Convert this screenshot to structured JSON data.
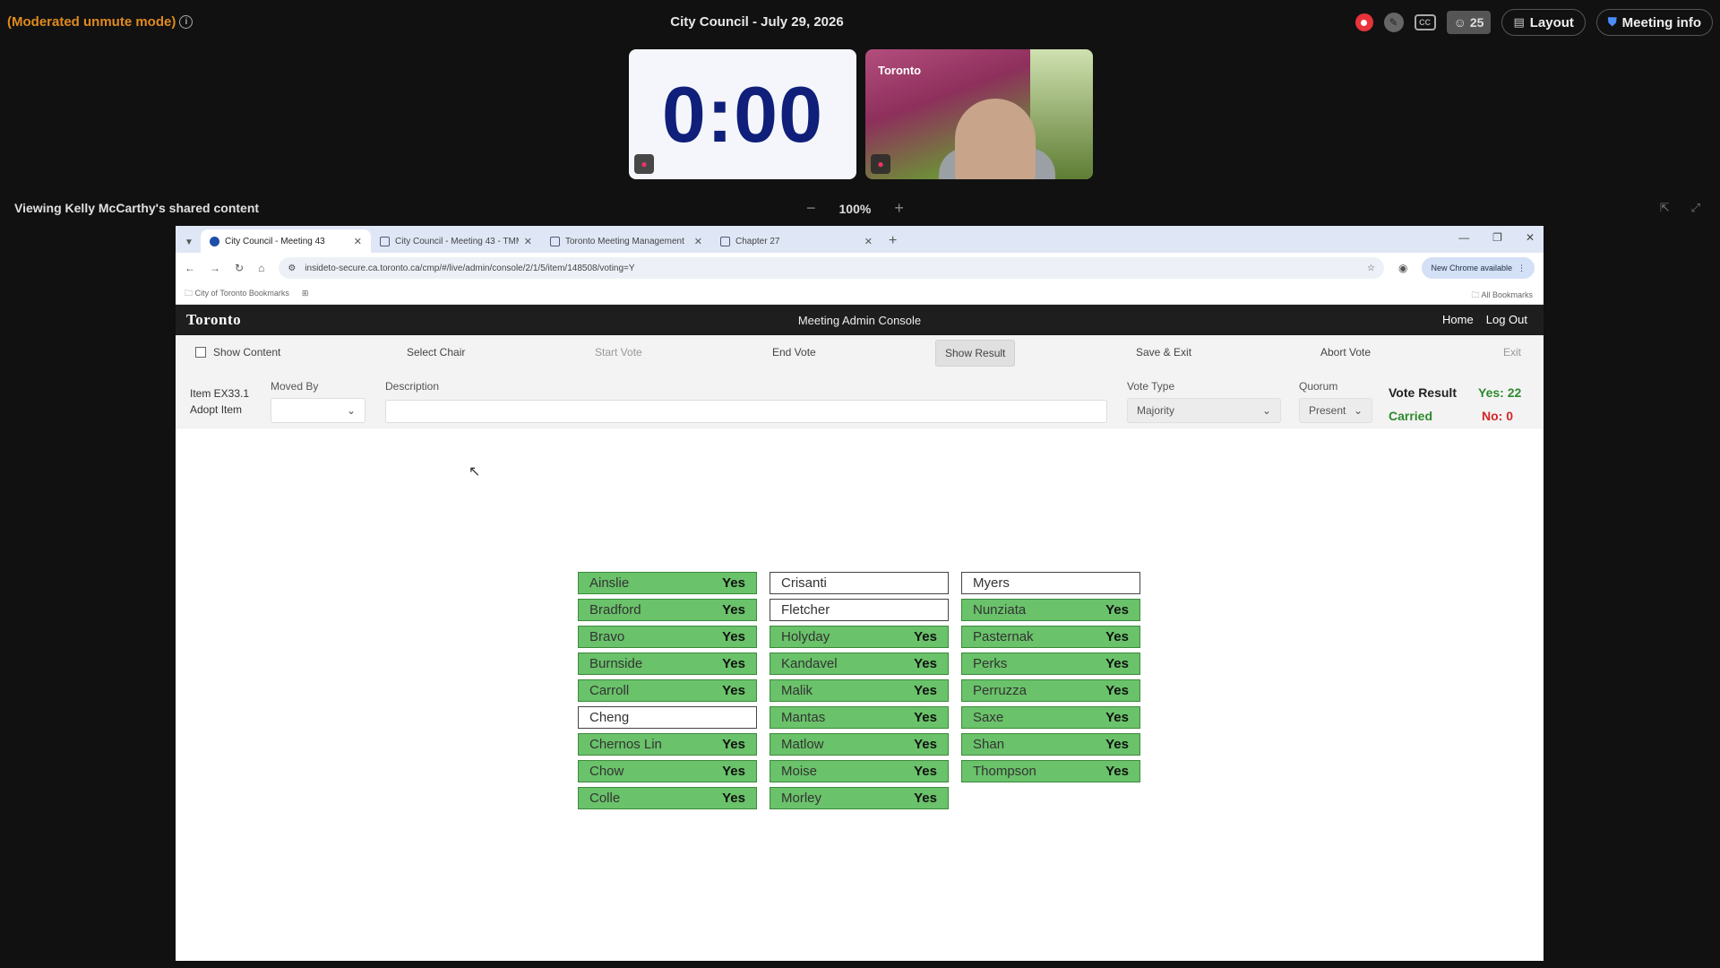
{
  "meeting": {
    "mode": "(Moderated unmute mode)",
    "title": "City Council - July 29, 2026",
    "participants": "25",
    "layout_label": "Layout",
    "info_label": "Meeting info",
    "timer": "0:00",
    "video_logo": "Toronto"
  },
  "share": {
    "label": "Viewing Kelly McCarthy's shared content",
    "zoom": "100%",
    "zoom_out": "−",
    "zoom_in": "+"
  },
  "browser": {
    "tabs": [
      {
        "label": "City Council - Meeting 43",
        "active": true
      },
      {
        "label": "City Council - Meeting 43 - TMMIS",
        "active": false
      },
      {
        "label": "Toronto Meeting Management",
        "active": false
      },
      {
        "label": "Chapter 27",
        "active": false
      }
    ],
    "url": "insideto-secure.ca.toronto.ca/cmp/#/live/admin/console/2/1/5/item/148508/voting=Y",
    "update_label": "New Chrome available",
    "bookmark_folder": "City of Toronto Bookmarks",
    "all_bookmarks": "All Bookmarks"
  },
  "app": {
    "logo": "Toronto",
    "title": "Meeting Admin Console",
    "nav_home": "Home",
    "nav_logout": "Log Out",
    "toolbar": {
      "show_content": "Show Content",
      "select_chair": "Select Chair",
      "start_vote": "Start Vote",
      "end_vote": "End Vote",
      "show_result": "Show Result",
      "save_exit": "Save & Exit",
      "abort_vote": "Abort Vote",
      "exit": "Exit"
    },
    "form": {
      "item_id": "Item EX33.1",
      "item_action": "Adopt Item",
      "moved_by_label": "Moved By",
      "description_label": "Description",
      "vote_type_label": "Vote Type",
      "vote_type_value": "Majority",
      "quorum_label": "Quorum",
      "quorum_value": "Present",
      "vote_result_label": "Vote Result",
      "vote_result_status": "Carried",
      "yes_count": "Yes: 22",
      "no_count": "No: 0"
    }
  },
  "votes": [
    [
      {
        "name": "Ainslie",
        "vote": "Yes"
      },
      {
        "name": "Bradford",
        "vote": "Yes"
      },
      {
        "name": "Bravo",
        "vote": "Yes"
      },
      {
        "name": "Burnside",
        "vote": "Yes"
      },
      {
        "name": "Carroll",
        "vote": "Yes"
      },
      {
        "name": "Cheng",
        "vote": ""
      },
      {
        "name": "Chernos Lin",
        "vote": "Yes"
      },
      {
        "name": "Chow",
        "vote": "Yes"
      },
      {
        "name": "Colle",
        "vote": "Yes"
      }
    ],
    [
      {
        "name": "Crisanti",
        "vote": ""
      },
      {
        "name": "Fletcher",
        "vote": ""
      },
      {
        "name": "Holyday",
        "vote": "Yes"
      },
      {
        "name": "Kandavel",
        "vote": "Yes"
      },
      {
        "name": "Malik",
        "vote": "Yes"
      },
      {
        "name": "Mantas",
        "vote": "Yes"
      },
      {
        "name": "Matlow",
        "vote": "Yes"
      },
      {
        "name": "Moise",
        "vote": "Yes"
      },
      {
        "name": "Morley",
        "vote": "Yes"
      }
    ],
    [
      {
        "name": "Myers",
        "vote": ""
      },
      {
        "name": "Nunziata",
        "vote": "Yes"
      },
      {
        "name": "Pasternak",
        "vote": "Yes"
      },
      {
        "name": "Perks",
        "vote": "Yes"
      },
      {
        "name": "Perruzza",
        "vote": "Yes"
      },
      {
        "name": "Saxe",
        "vote": "Yes"
      },
      {
        "name": "Shan",
        "vote": "Yes"
      },
      {
        "name": "Thompson",
        "vote": "Yes"
      }
    ]
  ],
  "colors": {
    "vote_yes": "#6ac26a",
    "carried": "#2d8a2d",
    "no": "#d42525",
    "mode_text": "#e08a1e",
    "timer_text": "#0f1f7a"
  }
}
